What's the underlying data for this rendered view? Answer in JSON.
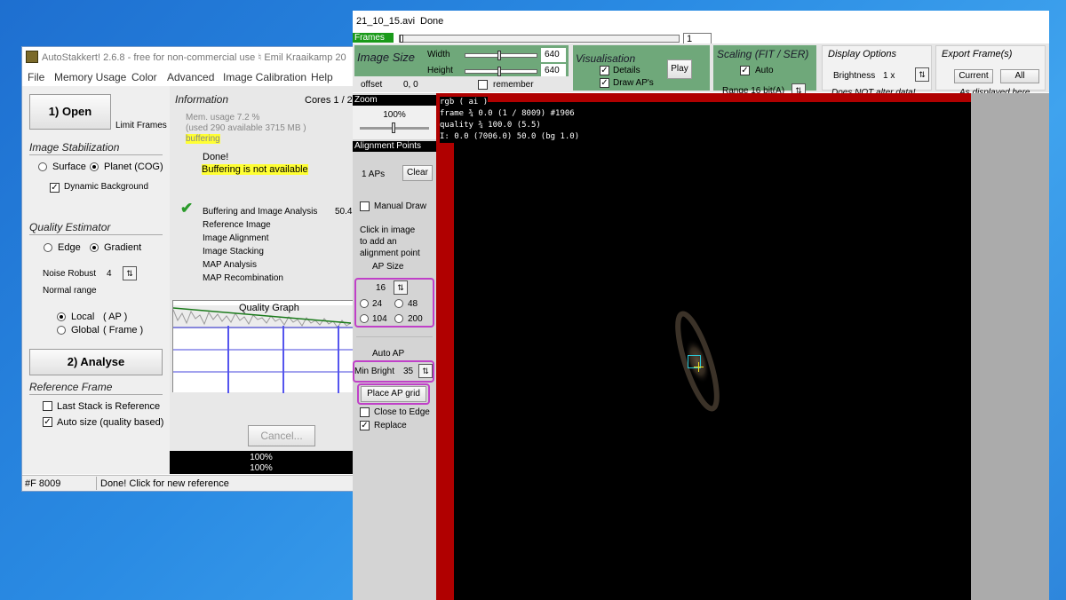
{
  "left_window": {
    "title": "AutoStakkert! 2.6.8 - free for non-commercial use ♮ Emil Kraaikamp 20",
    "menu": [
      "File",
      "Memory Usage",
      "Color",
      "Advanced",
      "Image Calibration",
      "Help"
    ],
    "open_label": "1) Open",
    "limit_frames": "Limit Frames",
    "stab_header": "Image Stabilization",
    "surface": "Surface",
    "planet": "Planet (COG)",
    "dynamic_bg": "Dynamic Background",
    "quality_header": "Quality Estimator",
    "edge": "Edge",
    "gradient": "Gradient",
    "noise_robust": "Noise Robust",
    "noise_value": "4",
    "normal_range": "Normal range",
    "local": "Local",
    "local_ap": "( AP )",
    "global": "Global",
    "global_frame": "( Frame )",
    "analyse_label": "2) Analyse",
    "ref_header": "Reference Frame",
    "last_stack": "Last Stack is Reference",
    "auto_size": "Auto size (quality based)",
    "info_header": "Information",
    "cores": "Cores 1 / 2",
    "mem_usage": "Mem. usage 7.2 %",
    "mem_used": "(used 290 available 3715 MB )",
    "buffering": "buffering",
    "done": "Done!",
    "buffering_na": "Buffering is not available",
    "steps": [
      "Buffering and Image Analysis",
      "Reference Image",
      "Image Alignment",
      "Image Stacking",
      "MAP Analysis",
      "MAP Recombination"
    ],
    "step1_value": "50.4",
    "graph_title": "Quality Graph",
    "cancel": "Cancel...",
    "progress1": "100%",
    "progress2": "100%",
    "status_frames": "#F 8009",
    "status_msg": "Done! Click for new reference"
  },
  "right_window": {
    "title_file": "21_10_15.avi",
    "title_status": "Done",
    "frames_label": "Frames",
    "frames_value": "1",
    "image_size_header": "Image Size",
    "width_label": "Width",
    "width_value": "640",
    "height_label": "Height",
    "height_value": "640",
    "offset_label": "offset",
    "offset_value": "0, 0",
    "remember": "remember",
    "vis_header": "Visualisation",
    "details": "Details",
    "draw_aps": "Draw AP's",
    "play": "Play",
    "scaling_header": "Scaling (FIT / SER)",
    "auto": "Auto",
    "range": "Range 16 bit(A)",
    "display_header": "Display Options",
    "brightness": "Brightness",
    "brightness_value": "1 x",
    "not_alter": "Does NOT alter data!",
    "export_header": "Export Frame(s)",
    "current": "Current",
    "all": "All",
    "as_displayed": "As displayed here",
    "zoom_header": "Zoom",
    "zoom_value": "100%",
    "ap_header": "Alignment Points",
    "aps_count": "1 APs",
    "clear": "Clear",
    "manual_draw": "Manual Draw",
    "click_hint": [
      "Click in image",
      "to add an",
      "alignment point"
    ],
    "ap_size": "AP Size",
    "ap_size_value": "16",
    "ap_sizes": [
      "24",
      "48",
      "104",
      "200"
    ],
    "auto_ap": "Auto AP",
    "min_bright": "Min Bright",
    "min_bright_value": "35",
    "place_grid": "Place AP grid",
    "close_edge": "Close to Edge",
    "replace": "Replace",
    "overlay": [
      "rgb ( ai )",
      "frame ¾ 0.0 (1 / 8009) #1906",
      "quality ¾ 100.0  (5.5)",
      "I: 0.0 (7006.0) 50.0 (bg 1.0)"
    ]
  }
}
